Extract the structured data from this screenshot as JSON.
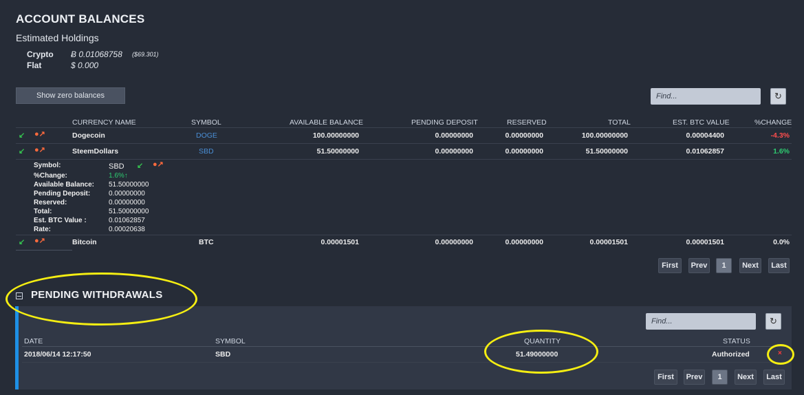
{
  "header": {
    "title": "ACCOUNT BALANCES",
    "subtitle": "Estimated Holdings"
  },
  "holdings": {
    "crypto_label": "Crypto",
    "crypto_value": "Ƀ 0.01068758",
    "crypto_usd": "($69.301)",
    "flat_label": "Flat",
    "flat_value": "$ 0.000"
  },
  "toolbar": {
    "zero_balances_label": "Show zero balances",
    "find_placeholder": "Find..."
  },
  "balances": {
    "columns": [
      "CURRENCY NAME",
      "SYMBOL",
      "AVAILABLE BALANCE",
      "PENDING DEPOSIT",
      "RESERVED",
      "TOTAL",
      "EST. BTC VALUE",
      "%CHANGE"
    ],
    "rows": [
      {
        "name": "Dogecoin",
        "symbol": "DOGE",
        "available": "100.00000000",
        "pending": "0.00000000",
        "reserved": "0.00000000",
        "total": "100.00000000",
        "btc": "0.00004400",
        "change": "-4.3%"
      },
      {
        "name": "SteemDollars",
        "symbol": "SBD",
        "available": "51.50000000",
        "pending": "0.00000000",
        "reserved": "0.00000000",
        "total": "51.50000000",
        "btc": "0.01062857",
        "change": "1.6%"
      },
      {
        "name": "Bitcoin",
        "symbol": "BTC",
        "available": "0.00001501",
        "pending": "0.00000000",
        "reserved": "0.00000000",
        "total": "0.00001501",
        "btc": "0.00001501",
        "change": "0.0%"
      }
    ],
    "detail": {
      "labels": [
        "Symbol:",
        "%Change:",
        "Available Balance:",
        "Pending Deposit:",
        "Reserved:",
        "Total:",
        "Est. BTC Value :",
        "Rate:"
      ],
      "values": [
        "SBD",
        "1.6%↑",
        "51.50000000",
        "0.00000000",
        "0.00000000",
        "51.50000000",
        "0.01062857",
        "0.00020638"
      ]
    }
  },
  "pagination": {
    "first": "First",
    "prev": "Prev",
    "page": "1",
    "next": "Next",
    "last": "Last"
  },
  "withdrawals": {
    "title": "PENDING WITHDRAWALS",
    "columns": [
      "DATE",
      "SYMBOL",
      "QUANTITY",
      "STATUS"
    ],
    "row": {
      "date": "2018/06/14 12:17:50",
      "symbol": "SBD",
      "quantity": "51.49000000",
      "status": "Authorized"
    },
    "cancel_glyph": "×"
  },
  "colors": {
    "background": "#262c37",
    "accent_blue": "#1e90e5",
    "positive": "#2ecc71",
    "negative": "#ff4d4d",
    "highlight": "#f5ee12"
  },
  "icons": {
    "deposit": "deposit-arrow-icon",
    "withdraw": "withdraw-arrow-icon",
    "refresh": "refresh-icon",
    "collapse": "collapse-icon",
    "cancel": "cancel-icon"
  }
}
